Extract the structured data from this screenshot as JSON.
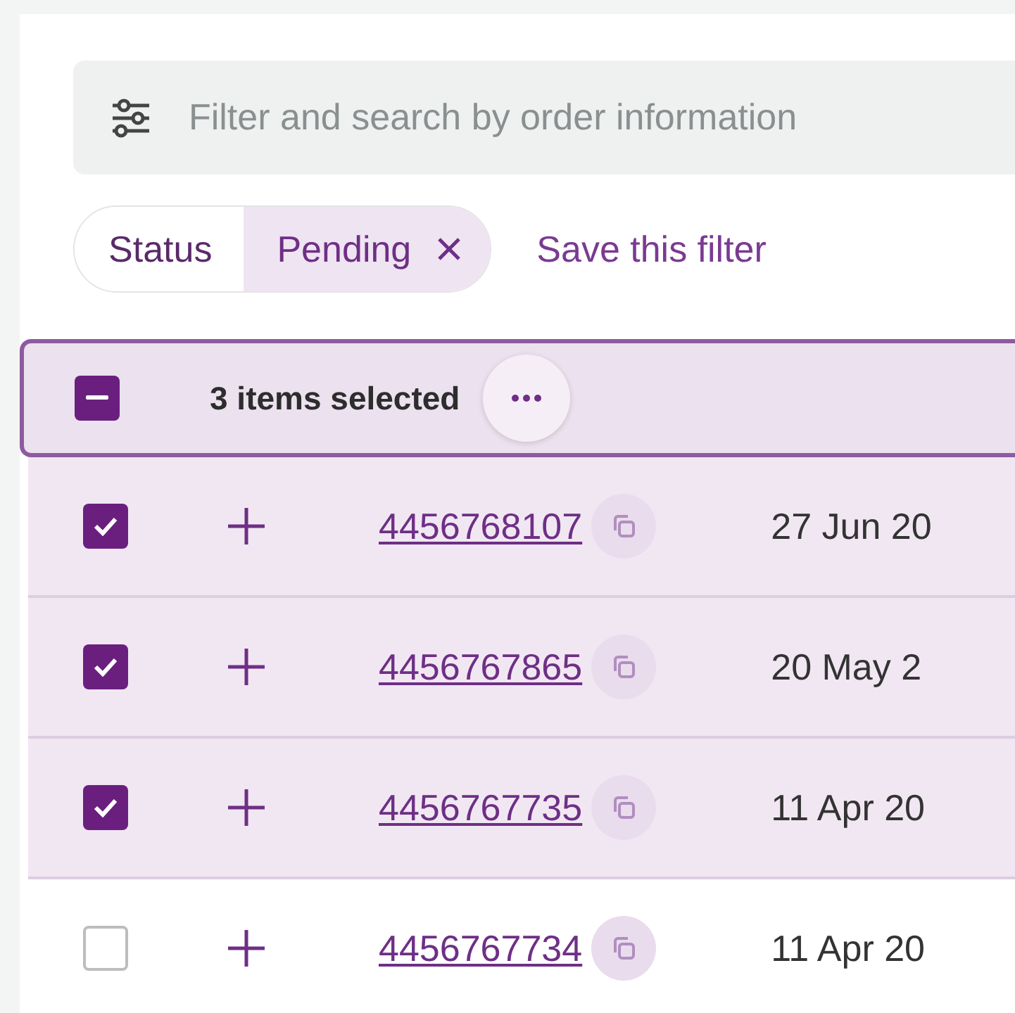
{
  "search": {
    "placeholder": "Filter and search by order information"
  },
  "filter_chip": {
    "label": "Status",
    "value": "Pending"
  },
  "save_filter": "Save this filter",
  "selection_bar": {
    "indeterminate": true,
    "label": "3 items selected"
  },
  "rows": [
    {
      "checked": true,
      "order": "4456768107",
      "date": "27 Jun 20"
    },
    {
      "checked": true,
      "order": "4456767865",
      "date": "20 May 2"
    },
    {
      "checked": true,
      "order": "4456767735",
      "date": "11 Apr 20"
    },
    {
      "checked": false,
      "order": "4456767734",
      "date": "11 Apr 20"
    }
  ]
}
